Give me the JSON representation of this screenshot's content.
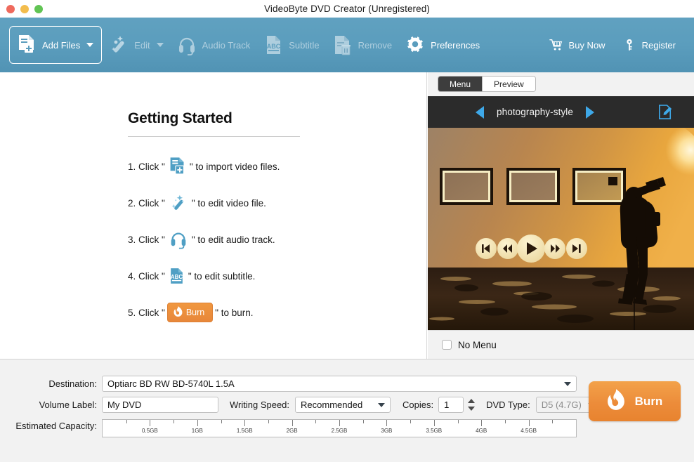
{
  "window": {
    "title": "VideoByte DVD Creator (Unregistered)",
    "traffic_lights": [
      "close",
      "minimize",
      "maximize"
    ]
  },
  "toolbar": {
    "items": [
      {
        "label": "Add Files",
        "icon": "add-files-icon",
        "has_caret": true,
        "enabled": true,
        "boxed": true
      },
      {
        "label": "Edit",
        "icon": "magic-wand-icon",
        "has_caret": true,
        "enabled": false,
        "boxed": false
      },
      {
        "label": "Audio Track",
        "icon": "headphones-icon",
        "has_caret": false,
        "enabled": false,
        "boxed": false
      },
      {
        "label": "Subtitle",
        "icon": "abc-document-icon",
        "has_caret": false,
        "enabled": false,
        "boxed": false
      },
      {
        "label": "Remove",
        "icon": "remove-document-icon",
        "has_caret": false,
        "enabled": false,
        "boxed": false
      },
      {
        "label": "Preferences",
        "icon": "gear-icon",
        "has_caret": false,
        "enabled": true,
        "boxed": false
      }
    ],
    "right_items": [
      {
        "label": "Buy Now",
        "icon": "cart-icon"
      },
      {
        "label": "Register",
        "icon": "key-icon"
      }
    ]
  },
  "getting_started": {
    "title": "Getting Started",
    "steps": [
      {
        "num": "1. Click \"",
        "icon": "add-files-icon",
        "tail": "\" to import video files."
      },
      {
        "num": "2. Click \"",
        "icon": "magic-wand-icon",
        "tail": "\" to edit video file."
      },
      {
        "num": "3. Click \"",
        "icon": "headphones-icon",
        "tail": "\" to edit audio track."
      },
      {
        "num": "4. Click \"",
        "icon": "abc-document-icon",
        "tail": "\" to edit subtitle."
      },
      {
        "num": "5. Click \"",
        "icon": "burn-chip",
        "chip_label": "Burn",
        "tail": "\" to burn."
      }
    ]
  },
  "right_panel": {
    "tabs": [
      {
        "label": "Menu",
        "active": true
      },
      {
        "label": "Preview",
        "active": false
      }
    ],
    "menu_template": "photography-style",
    "prev_icon": "arrow-left-icon",
    "next_icon": "arrow-right-icon",
    "edit_icon": "edit-pencil-icon",
    "preview_alt": "photographer-silhouette-sunset-menu-background",
    "no_menu": {
      "label": "No Menu",
      "checked": false
    }
  },
  "bottom": {
    "destination": {
      "label": "Destination:",
      "value": "Optiarc BD RW BD-5740L 1.5A"
    },
    "volume_label": {
      "label": "Volume Label:",
      "value": "My DVD"
    },
    "writing_speed": {
      "label": "Writing Speed:",
      "value": "Recommended"
    },
    "copies": {
      "label": "Copies:",
      "value": "1"
    },
    "dvd_type": {
      "label": "DVD Type:",
      "value": "D5 (4.7G)"
    },
    "estimated_capacity": {
      "label": "Estimated Capacity:",
      "ticks": [
        "0.5GB",
        "1GB",
        "1.5GB",
        "2GB",
        "2.5GB",
        "3GB",
        "3.5GB",
        "4GB",
        "4.5GB"
      ],
      "max": "5GB",
      "fill_percent": 0
    },
    "burn_button": {
      "label": "Burn",
      "icon": "flame-icon"
    }
  },
  "colors": {
    "toolbar_blue": "#5b9dbd",
    "accent_orange": "#ec8c3a",
    "menu_bar_dark": "#2b2b2b",
    "icon_blue": "#3ea8e8",
    "step_icon_blue": "#4f9fc4"
  }
}
